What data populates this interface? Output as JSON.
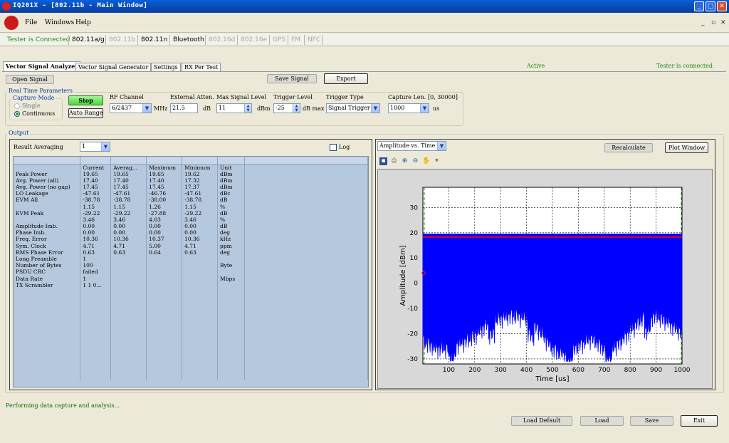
{
  "window": {
    "title": "IQ201X - [802.11b - Main Window]",
    "min_glyph": "_",
    "max_glyph": "□",
    "close_glyph": "✕"
  },
  "menu": {
    "items": [
      "File",
      "Windows",
      "Help"
    ],
    "mdi_controls": [
      "_",
      "▫",
      "✕"
    ]
  },
  "protocols": {
    "status": "Tester is Connected",
    "items": [
      "802.11a/g",
      "802.11b",
      "802.11n",
      "Bluetooth",
      "802.16d",
      "802.16e",
      "GPS",
      "FM",
      "NFC"
    ],
    "enabled": [
      true,
      false,
      true,
      true,
      false,
      false,
      false,
      false,
      false
    ]
  },
  "tabs": [
    "Vector Signal Analyzer",
    "Vector Signal Generator",
    "Settings",
    "RX Per Test"
  ],
  "header_status": {
    "active": "Active",
    "connection": "Tester is connected"
  },
  "buttons": {
    "open_signal": "Open Signal",
    "save_signal": "Save Signal",
    "export": "Export",
    "stop": "Stop",
    "auto_range": "Auto Range",
    "recalculate": "Recalculate",
    "plot_window": "Plot Window",
    "load_default": "Load Default",
    "load": "Load",
    "save": "Save",
    "exit": "Exit"
  },
  "realtime": {
    "group_title": "Real Time Parameters",
    "capture_mode_title": "Capture Mode",
    "mode_single": "Single",
    "mode_continuous": "Continuous",
    "selected_mode": "Continuous",
    "rf_channel_label": "RF Channel",
    "rf_channel_value": "6/2437",
    "rf_unit": "MHz",
    "ext_atten_label": "External Atten.",
    "ext_atten_value": "21.5",
    "ext_atten_unit": "dB",
    "max_level_label": "Max Signal Level",
    "max_level_value": "11",
    "max_level_unit": "dBm",
    "trigger_level_label": "Trigger Level",
    "trigger_level_value": "-25",
    "trigger_level_unit": "dB max",
    "trigger_type_label": "Trigger Type",
    "trigger_type_value": "Signal Trigger",
    "capture_len_label": "Capture Len.",
    "capture_len_range": "[0, 30000]",
    "capture_len_value": "1000",
    "capture_len_unit": "us"
  },
  "output": {
    "group_title": "Output",
    "result_averaging_label": "Result Averaging",
    "result_averaging_value": "1",
    "log_label": "Log",
    "log_checked": false,
    "columns": [
      "",
      "Current",
      "Averag...",
      "Maximum",
      "Minimum",
      "Unit"
    ],
    "rows": [
      [
        "Peak Power",
        "19.65",
        "19.65",
        "19.65",
        "19.62",
        "dBm"
      ],
      [
        "Avg. Power (all)",
        "17.40",
        "17.40",
        "17.40",
        "17.32",
        "dBm"
      ],
      [
        "Avg. Power (no gap)",
        "17.45",
        "17.45",
        "17.45",
        "17.37",
        "dBm"
      ],
      [
        "LO Leakage",
        "-47.61",
        "-47.61",
        "-46.76",
        "-47.61",
        "dBc"
      ],
      [
        "EVM All",
        "-38.78",
        "-38.78",
        "-38.00",
        "-38.78",
        "dB"
      ],
      [
        "",
        "1.15",
        "1.15",
        "1.26",
        "1.15",
        "%"
      ],
      [
        "EVM Peak",
        "-29.22",
        "-29.22",
        "-27.88",
        "-29.22",
        "dB"
      ],
      [
        "",
        "3.46",
        "3.46",
        "4.03",
        "3.46",
        "%"
      ],
      [
        "Amplitude Imb.",
        "0.00",
        "0.00",
        "0.00",
        "0.00",
        "dB"
      ],
      [
        "Phase Imb.",
        "0.00",
        "0.00",
        "0.00",
        "0.00",
        "deg"
      ],
      [
        "Freq. Error",
        "10.36",
        "10.36",
        "10.37",
        "10.36",
        "kHz"
      ],
      [
        "Sym. Clock",
        "4.71",
        "4.71",
        "5.00",
        "4.71",
        "ppm"
      ],
      [
        "RMS Phase Error",
        "0.63",
        "0.63",
        "0.64",
        "0.63",
        "deg"
      ],
      [
        "Long Preamble",
        "1",
        "",
        "",
        "",
        ""
      ],
      [
        "Number of Bytes",
        "100",
        "",
        "",
        "",
        "Byte"
      ],
      [
        "PSDU CRC",
        "failed",
        "",
        "",
        "",
        ""
      ],
      [
        "Data Rate",
        "1",
        "",
        "",
        "",
        "Mbps"
      ],
      [
        "TX Scrambler",
        "1 1 0...",
        "",
        "",
        "",
        ""
      ]
    ]
  },
  "plot": {
    "selector_value": "Amplitude vs. Time",
    "toolbar_icons": [
      "save-icon",
      "print-icon",
      "zoom-in-icon",
      "zoom-out-icon",
      "pan-hand-icon",
      "data-cursor-icon"
    ]
  },
  "chart_data": {
    "type": "line",
    "title": "",
    "xlabel": "Time [us]",
    "ylabel": "Amplitude [dBm]",
    "xlim": [
      0,
      1000
    ],
    "ylim": [
      -32,
      38
    ],
    "xticks": [
      100,
      200,
      300,
      400,
      500,
      600,
      700,
      800,
      900,
      1000
    ],
    "yticks": [
      30,
      20,
      10,
      0,
      -10,
      -20,
      -30
    ],
    "grid": true,
    "series": [
      {
        "name": "",
        "color": "#0000ff",
        "envelope_top": 19.5,
        "floor_x": [
          0,
          50,
          100,
          150,
          200,
          250,
          300,
          350,
          400,
          450,
          500,
          550,
          600,
          650,
          700,
          750,
          800,
          850,
          900,
          950,
          1000
        ],
        "floor_y": [
          -22,
          -25,
          -25,
          -23,
          -20,
          -15,
          -13,
          -12,
          -13,
          -18,
          -25,
          -28,
          -24,
          -21,
          -25,
          -24,
          -18,
          -13,
          -12,
          -15,
          -19
        ]
      },
      {
        "name": "",
        "color": "#ff0000",
        "level": 18.3
      }
    ]
  },
  "status_line": "Performing data capture and analysis..."
}
